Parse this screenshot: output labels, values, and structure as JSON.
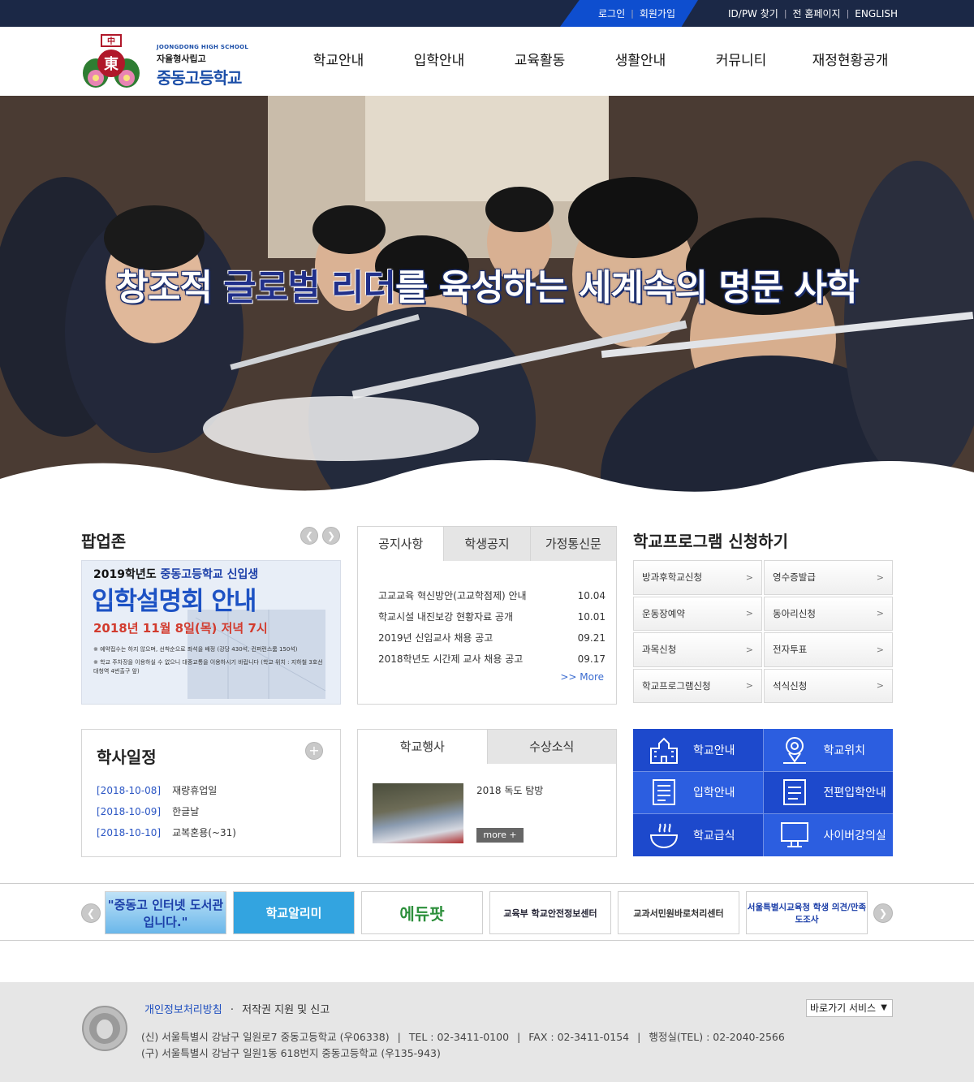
{
  "topbar": {
    "login": "로그인",
    "join": "회원가입",
    "find_idpw": "ID/PW 찾기",
    "old_site": "전 홈페이지",
    "english": "ENGLISH"
  },
  "logo": {
    "small_en": "JOONGDONG HIGH SCHOOL",
    "subtitle": "자율형사립고",
    "name": "중동고등학교"
  },
  "gnb": [
    "학교안내",
    "입학안내",
    "교육활동",
    "생활안내",
    "커뮤니티",
    "재정현황공개"
  ],
  "hero": {
    "slogan_1": "창조적 ",
    "slogan_accent": "글로벌 리더",
    "slogan_2": "를 육성하는 세계속의 명문 사학"
  },
  "popup_zone": {
    "title": "팝업존",
    "image_line1_a": "2019학년도 ",
    "image_line1_b": "중동고등학교 신입생",
    "image_line2": "입학설명회 안내",
    "image_line3": "2018년 11월 8일(목) 저녁 7시",
    "image_note1": "※ 예약접수는 하지 않으며, 선착순으로 좌석을 배정 (강당 430석, 컨퍼런스룸 150석)",
    "image_note2": "※ 학교 주차장을 이용하실 수 없으니 대중교통을 이용하시기 바랍니다 (학교 위치 : 지하철 3호선 대청역 4번출구 앞)"
  },
  "notice": {
    "tabs": [
      "공지사항",
      "학생공지",
      "가정통신문"
    ],
    "items": [
      {
        "title": "고교교육 혁신방안(고교학점제) 안내",
        "date": "10.04"
      },
      {
        "title": "학교시설 내진보강 현황자료 공개",
        "date": "10.01"
      },
      {
        "title": "2019년 신임교사 채용 공고",
        "date": "09.21"
      },
      {
        "title": "2018학년도 시간제 교사 채용 공고",
        "date": "09.17"
      }
    ],
    "more": ">> More"
  },
  "program": {
    "title": "학교프로그램 신청하기",
    "items": [
      "방과후학교신청",
      "영수증발급",
      "운동장예약",
      "동아리신청",
      "과목신청",
      "전자투표",
      "학교프로그램신청",
      "석식신청"
    ]
  },
  "schedule": {
    "title": "학사일정",
    "items": [
      {
        "date": "[2018-10-08]",
        "event": "재량휴업일"
      },
      {
        "date": "[2018-10-09]",
        "event": "한글날"
      },
      {
        "date": "[2018-10-10]",
        "event": "교복혼용(~31)"
      }
    ]
  },
  "events": {
    "tabs": [
      "학교행사",
      "수상소식"
    ],
    "item_title": "2018 독도 탐방",
    "more": "more +"
  },
  "quick_links": [
    "학교안내",
    "학교위치",
    "입학안내",
    "전편입학안내",
    "학교급식",
    "사이버강의실"
  ],
  "banners": [
    "\"중동고 인터넷 도서관입니다.\"",
    "학교알리미",
    "에듀팟",
    "교육부 학교안전정보센터",
    "교과서민원바로처리센터",
    "서울특별시교육청 학생 의견/만족도조사"
  ],
  "footer": {
    "privacy": "개인정보처리방침",
    "copyright": "저작권 지원 및 신고",
    "shortcut": "바로가기 서비스",
    "addr_new": "(신) 서울특별시 강남구 일원로7 중동고등학교 (우06338)",
    "tel": "TEL : 02-3411-0100",
    "fax": "FAX : 02-3411-0154",
    "admin_tel": "행정실(TEL) : 02-2040-2566",
    "addr_old": "(구) 서울특별시 강남구 일원1동 618번지 중동고등학교 (우135-943)"
  },
  "colors": {
    "topbar": "#1b2846",
    "accent_blue": "#0e4ecf",
    "quick_blue": "#1d49cc"
  }
}
